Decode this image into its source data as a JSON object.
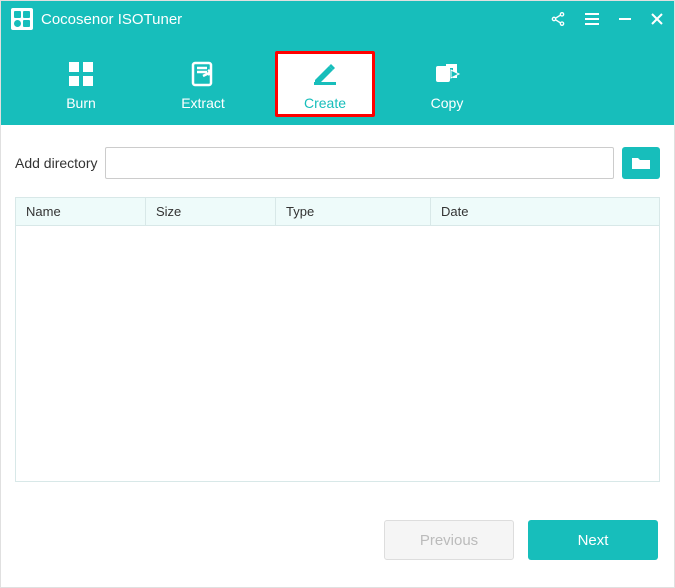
{
  "app": {
    "title": "Cocosenor ISOTuner"
  },
  "toolbar": {
    "burn": {
      "label": "Burn"
    },
    "extract": {
      "label": "Extract"
    },
    "create": {
      "label": "Create"
    },
    "copy": {
      "label": "Copy"
    }
  },
  "add": {
    "label": "Add directory",
    "value": ""
  },
  "table": {
    "columns": {
      "name": "Name",
      "size": "Size",
      "type": "Type",
      "date": "Date"
    },
    "rows": []
  },
  "footer": {
    "previous": "Previous",
    "next": "Next"
  },
  "colors": {
    "accent": "#17bebb",
    "highlight_border": "#ff0000"
  }
}
